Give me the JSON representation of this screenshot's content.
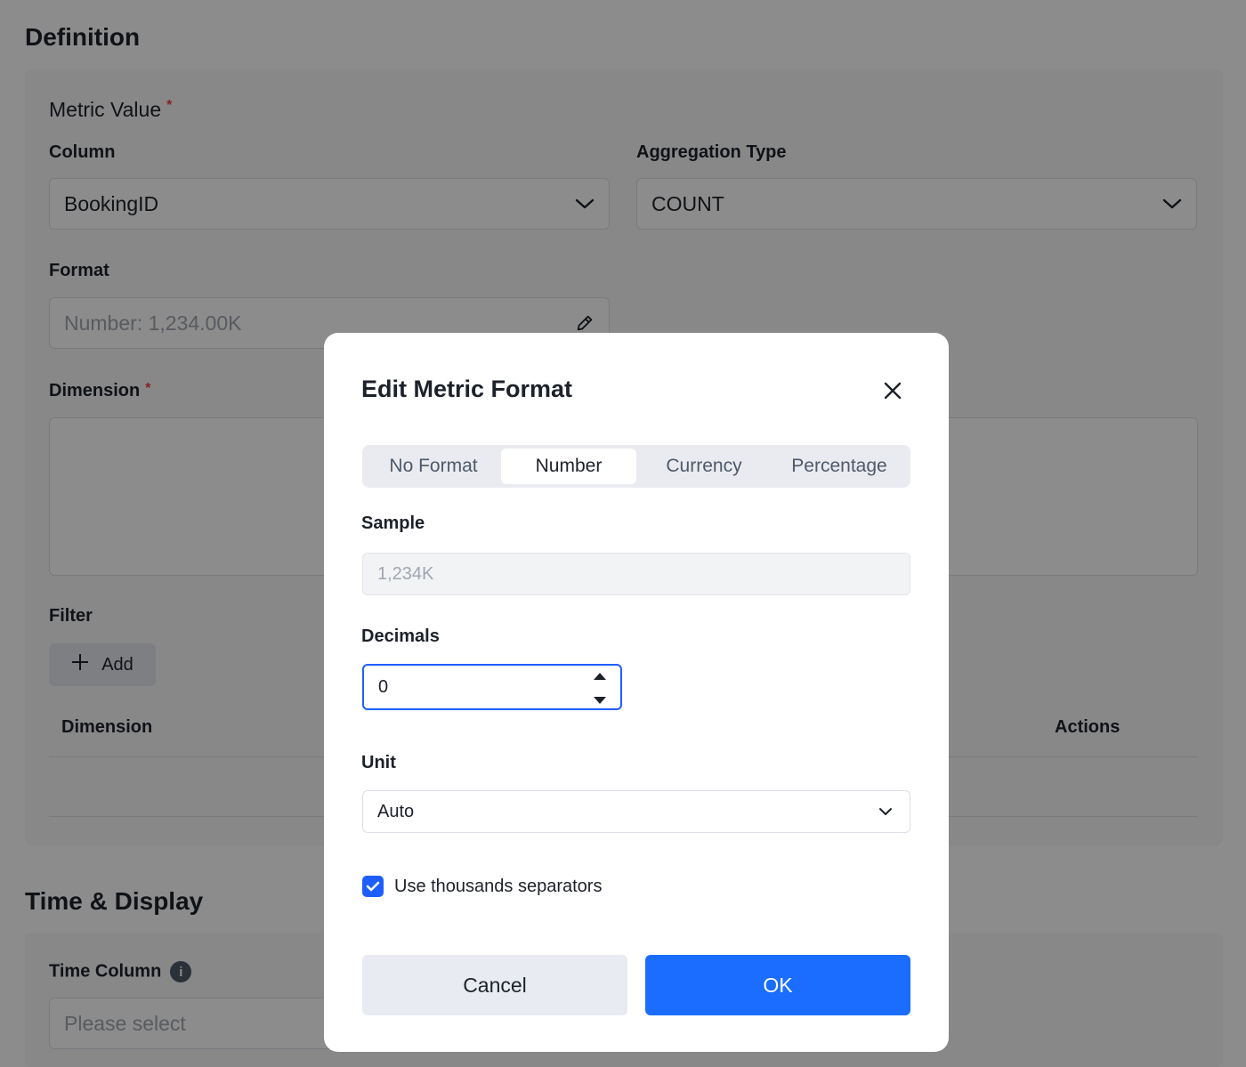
{
  "definition": {
    "title": "Definition",
    "metric_value_label": "Metric Value",
    "column": {
      "label": "Column",
      "value": "BookingID"
    },
    "aggregation": {
      "label": "Aggregation Type",
      "value": "COUNT"
    },
    "format": {
      "label": "Format",
      "value": "Number: 1,234.00K"
    },
    "dimension_label": "Dimension",
    "filter": {
      "label": "Filter",
      "add_label": "Add"
    },
    "table_headers": [
      "Dimension",
      "Actions"
    ]
  },
  "time_display": {
    "title": "Time & Display",
    "time_column": {
      "label": "Time Column",
      "placeholder": "Please select"
    }
  },
  "modal": {
    "title": "Edit Metric Format",
    "tabs": [
      {
        "label": "No Format",
        "active": false
      },
      {
        "label": "Number",
        "active": true
      },
      {
        "label": "Currency",
        "active": false
      },
      {
        "label": "Percentage",
        "active": false
      }
    ],
    "sample": {
      "label": "Sample",
      "value": "1,234K"
    },
    "decimals": {
      "label": "Decimals",
      "value": "0"
    },
    "unit": {
      "label": "Unit",
      "value": "Auto"
    },
    "thousands": {
      "label": "Use thousands separators",
      "checked": true
    },
    "cancel_label": "Cancel",
    "ok_label": "OK"
  },
  "colors": {
    "primary": "#1a6dff",
    "required": "#f53f3f",
    "overlay": "rgba(0,0,0,0.45)"
  }
}
